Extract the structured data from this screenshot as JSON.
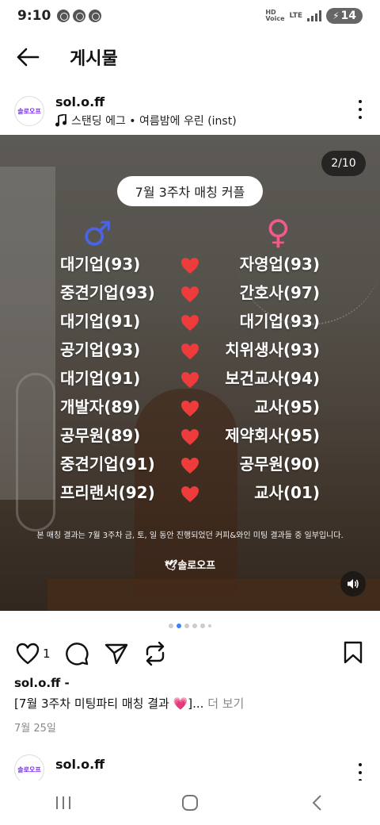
{
  "status_bar": {
    "time": "9:10",
    "hd": "HD",
    "voice": "Voice",
    "lte": "LTE",
    "lte_sub": "LTE",
    "battery": "14"
  },
  "header": {
    "title": "게시물"
  },
  "post": {
    "username": "sol.o.ff",
    "avatar_text": "솔로오프",
    "music": "스탠딩 에그 • 여름밤에 우린 (inst)"
  },
  "media": {
    "counter": "2/10",
    "week_title": "7월 3주차 매칭 커플",
    "male_symbol": "♂",
    "female_symbol": "♀",
    "heart_color": "#ee3b3b",
    "male_color": "#4a63e8",
    "female_color": "#f25a8c",
    "matches": [
      {
        "left": "대기업(93)",
        "right": "자영업(93)"
      },
      {
        "left": "중견기업(93)",
        "right": "간호사(97)"
      },
      {
        "left": "대기업(91)",
        "right": "대기업(93)"
      },
      {
        "left": "공기업(93)",
        "right": "치위생사(93)"
      },
      {
        "left": "대기업(91)",
        "right": "보건교사(94)"
      },
      {
        "left": "개발자(89)",
        "right": "교사(95)"
      },
      {
        "left": "공무원(89)",
        "right": "제약회사(95)"
      },
      {
        "left": "중견기업(91)",
        "right": "공무원(90)"
      },
      {
        "left": "프리랜서(92)",
        "right": "교사(01)"
      }
    ],
    "footnote": "본 매칭 결과는 7월 3주차 금, 토, 일 동안 진행되었던 커피&와인 미팅 결과들 중 일부입니다.",
    "brand": "솔로오프"
  },
  "actions": {
    "like_count": "1"
  },
  "caption": {
    "username": "sol.o.ff",
    "username_suffix": " -",
    "text": "[7월 3주차 미팅파티 매칭 결과 💗]...",
    "more": " 더 보기",
    "date": "7월 25일"
  },
  "next_post": {
    "username": "sol.o.ff",
    "avatar_text": "솔로오프"
  }
}
